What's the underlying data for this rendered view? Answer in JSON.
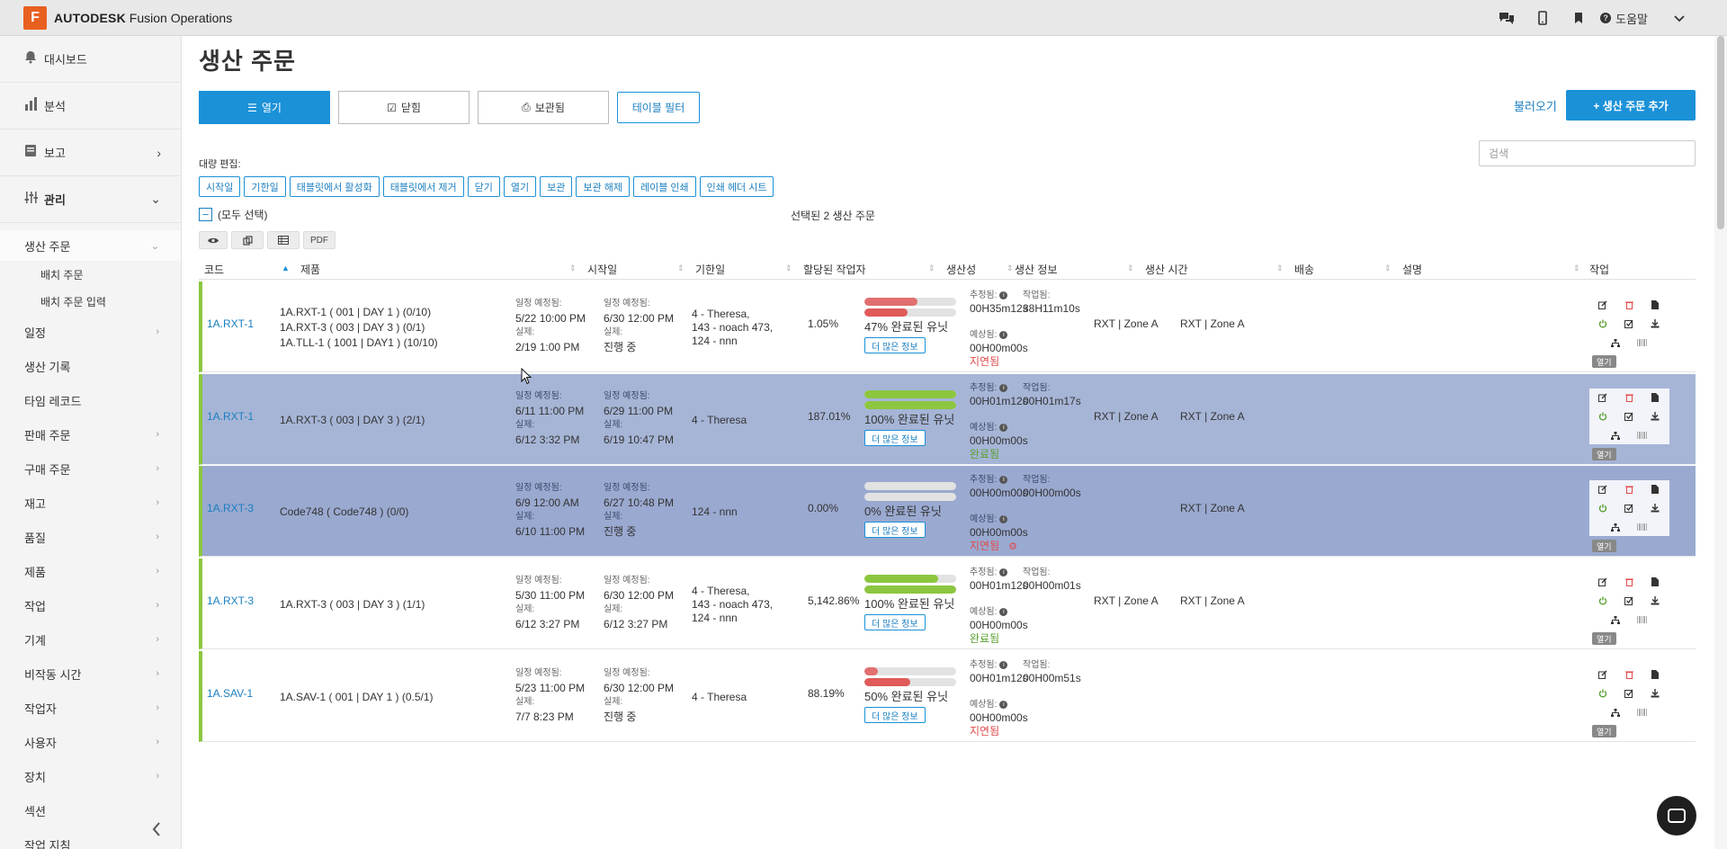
{
  "app": {
    "logo_letter": "F",
    "brand_bold": "AUTODESK",
    "brand_rest": " Fusion Operations"
  },
  "topbar": {
    "help_label": "도움말",
    "icons": [
      "chat-icon",
      "mobile-icon",
      "bookmark-icon",
      "help-icon",
      "chevron-down-icon"
    ]
  },
  "sidebar": {
    "main_items": [
      {
        "label": "대시보드",
        "icon": "bell-icon"
      },
      {
        "label": "분석",
        "icon": "bar-chart-icon"
      },
      {
        "label": "보고",
        "icon": "report-icon"
      },
      {
        "label": "관리",
        "icon": "sliders-icon"
      }
    ],
    "active_item": "생산 주문",
    "sub_items": [
      "배치 주문",
      "배치 주문 입력"
    ],
    "items": [
      "일정",
      "생산 기록",
      "타임 레코드",
      "판매 주문",
      "구매 주문",
      "재고",
      "품질",
      "제품",
      "작업",
      "기계",
      "비작동 시간",
      "작업자",
      "사용자",
      "장치",
      "섹션",
      "작업 지침"
    ]
  },
  "page": {
    "title": "생산 주문",
    "tabs": [
      "열기",
      "닫힘",
      "보관됨"
    ],
    "filter_label": "테이블 필터",
    "load_label": "불러오기",
    "add_label": "+ 생산 주문 추가",
    "search_placeholder": "검색",
    "bulk_label": "대량 편집:",
    "bulk_buttons": [
      "시작일",
      "기한일",
      "태블릿에서 활성화",
      "태블릿에서 제거",
      "닫기",
      "열기",
      "보관",
      "보관 해제",
      "레이블 인쇄",
      "인쇄 헤더 시트"
    ],
    "select_all": "(모두 선택)",
    "selected_count": "선택된 2 생산 주문",
    "view_pdf": "PDF"
  },
  "table": {
    "columns": [
      "코드",
      "제품",
      "시작일",
      "기한일",
      "할당된 작업자",
      "생산성",
      "생산 정보",
      "생산 시간",
      "배송",
      "설명",
      "작업"
    ],
    "labels": {
      "scheduled": "일정 예정됨:",
      "actual": "실제:",
      "estimated": "추정됨:",
      "worked": "작업됨:",
      "expected": "예상됨:",
      "more_info": "더 많은 정보",
      "open": "열기"
    },
    "rows": [
      {
        "code": "1A.RXT-1",
        "products": [
          "1A.RXT-1 ( 001 | DAY 1 ) (0/10)",
          "1A.RXT-3 ( 003 | DAY 3 ) (0/1)",
          "1A.TLL-1 ( 1001 | DAY1 ) (10/10)"
        ],
        "start_sched": "5/22  10:00 PM",
        "start_actual": "2/19  1:00 PM",
        "due_sched": "6/30  12:00 PM",
        "due_actual": "진행 중",
        "workers": [
          "4 - Theresa,",
          "143 - noach 473,",
          "124 - nnn"
        ],
        "productivity": "1.05%",
        "bar_top": 0.58,
        "bar_bottom": 0.47,
        "bar_color": "#e05a5a",
        "units_done": "47% 완료된 유닛",
        "est_time": "00H35m12s",
        "worked_time": "38H11m10s",
        "expected_time": "00H00m00s",
        "status": "지연됨",
        "status_color": "red",
        "shipping": "RXT | Zone A",
        "description": "RXT | Zone A",
        "selected": false
      },
      {
        "code": "1A.RXT-1",
        "products": [
          "1A.RXT-3 ( 003 | DAY 3 ) (2/1)"
        ],
        "start_sched": "6/11  11:00 PM",
        "start_actual": "6/12  3:32 PM",
        "due_sched": "6/29  11:00 PM",
        "due_actual": "6/19  10:47 PM",
        "workers": [
          "4 - Theresa"
        ],
        "productivity": "187.01%",
        "bar_top": 1.0,
        "bar_bottom": 1.0,
        "bar_color": "#8cc63f",
        "units_done": "100% 완료된 유닛",
        "est_time": "00H01m12s",
        "worked_time": "00H01m17s",
        "expected_time": "00H00m00s",
        "status": "완료됨",
        "status_color": "green",
        "shipping": "RXT | Zone A",
        "description": "RXT | Zone A",
        "selected": true
      },
      {
        "code": "1A.RXT-3",
        "products": [
          "Code748 ( Code748 ) (0/0)"
        ],
        "start_sched": "6/9  12:00 AM",
        "start_actual": "6/10  11:00 PM",
        "due_sched": "6/27  10:48 PM",
        "due_actual": "진행 중",
        "workers": [
          "124 - nnn"
        ],
        "productivity": "0.00%",
        "bar_top": 0,
        "bar_bottom": 0,
        "bar_color": "#e05a5a",
        "units_done": "0% 완료된 유닛",
        "est_time": "00H00m00s",
        "worked_time": "00H00m00s",
        "expected_time": "00H00m00s",
        "status": "지연됨",
        "status_color": "red",
        "shipping": "",
        "description": "RXT | Zone A",
        "selected": true
      },
      {
        "code": "1A.RXT-3",
        "products": [
          "1A.RXT-3 ( 003 | DAY 3 ) (1/1)"
        ],
        "start_sched": "5/30  11:00 PM",
        "start_actual": "6/12  3:27 PM",
        "due_sched": "6/30  12:00 PM",
        "due_actual": "6/12  3:27 PM",
        "workers": [
          "4 - Theresa,",
          "143 - noach 473,",
          "124 - nnn"
        ],
        "productivity": "5,142.86%",
        "bar_top": 0.8,
        "bar_bottom": 1.0,
        "bar_color": "#8cc63f",
        "units_done": "100% 완료된 유닛",
        "est_time": "00H01m12s",
        "worked_time": "00H00m01s",
        "expected_time": "00H00m00s",
        "status": "완료됨",
        "status_color": "green",
        "shipping": "RXT | Zone A",
        "description": "RXT | Zone A",
        "selected": false
      },
      {
        "code": "1A.SAV-1",
        "products": [
          "1A.SAV-1 ( 001 | DAY 1 ) (0.5/1)"
        ],
        "start_sched": "5/23  11:00 PM",
        "start_actual": "7/7  8:23 PM",
        "due_sched": "6/30  12:00 PM",
        "due_actual": "진행 중",
        "workers": [
          "4 - Theresa"
        ],
        "productivity": "88.19%",
        "bar_top": 0.15,
        "bar_bottom": 0.5,
        "bar_color": "#e05a5a",
        "units_done": "50% 완료된 유닛",
        "est_time": "00H01m12s",
        "worked_time": "00H00m51s",
        "expected_time": "00H00m00s",
        "status": "지연됨",
        "status_color": "red",
        "shipping": "",
        "description": "",
        "selected": false
      }
    ]
  }
}
